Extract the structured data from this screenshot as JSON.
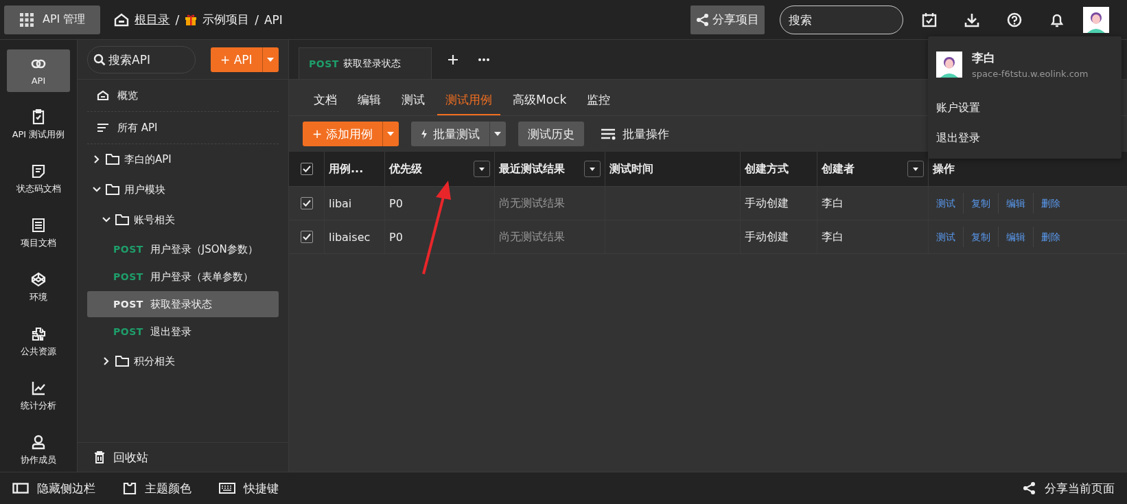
{
  "topbar": {
    "app_button": "API 管理",
    "breadcrumb": [
      {
        "label": "根目录",
        "kind": "home"
      },
      {
        "separator": "/",
        "label": "示例项目",
        "kind": "gift"
      },
      {
        "separator": "/",
        "label": "API",
        "kind": "plain"
      }
    ],
    "share_button": "分享项目",
    "search": {
      "placeholder": "搜索"
    }
  },
  "account_menu": {
    "name": "李白",
    "space": "space-f6tstu.w.eolink.com",
    "items": [
      "账户设置",
      "退出登录"
    ]
  },
  "rail": [
    {
      "label": "API",
      "selected": true
    },
    {
      "label": "API 测试用例",
      "selected": false
    },
    {
      "label": "状态码文档",
      "selected": false
    },
    {
      "label": "项目文档",
      "selected": false
    },
    {
      "label": "环境",
      "selected": false
    },
    {
      "label": "公共资源",
      "selected": false
    },
    {
      "label": "统计分析",
      "selected": false
    },
    {
      "label": "协作成员",
      "selected": false
    }
  ],
  "sidebar": {
    "search": {
      "placeholder": "搜索API"
    },
    "add_button": "+ API",
    "links": [
      "概览",
      "所有 API"
    ],
    "tree": [
      {
        "kind": "folder",
        "label": "李白的API",
        "expanded": false
      },
      {
        "kind": "folder",
        "label": "用户模块",
        "expanded": true,
        "children": [
          {
            "kind": "folder",
            "label": "账号相关",
            "expanded": true,
            "children": [
              {
                "kind": "api",
                "method": "POST",
                "label": "用户登录（JSON参数）",
                "selected": false
              },
              {
                "kind": "api",
                "method": "POST",
                "label": "用户登录（表单参数）",
                "selected": false
              },
              {
                "kind": "api",
                "method": "POST",
                "label": "获取登录状态",
                "selected": true
              },
              {
                "kind": "api",
                "method": "POST",
                "label": "退出登录",
                "selected": false
              }
            ]
          },
          {
            "kind": "folder",
            "label": "积分相关",
            "expanded": false
          }
        ]
      }
    ],
    "recycle": "回收站"
  },
  "open_tab": {
    "method": "POST",
    "title": "获取登录状态"
  },
  "subtabs": [
    {
      "label": "文档",
      "selected": false
    },
    {
      "label": "编辑",
      "selected": false
    },
    {
      "label": "测试",
      "selected": false
    },
    {
      "label": "测试用例",
      "selected": true
    },
    {
      "label": "高级Mock",
      "selected": false
    },
    {
      "label": "监控",
      "selected": false
    }
  ],
  "toolbar": {
    "add_case": "+ 添加用例",
    "batch_test": "批量测试",
    "history": "测试历史",
    "batch_ops": "批量操作"
  },
  "table": {
    "all_checked": true,
    "columns": [
      {
        "label": "用例...",
        "filter": false
      },
      {
        "label": "优先级",
        "filter": true
      },
      {
        "label": "最近测试结果",
        "filter": true
      },
      {
        "label": "测试时间",
        "filter": false
      },
      {
        "label": "创建方式",
        "filter": false
      },
      {
        "label": "创建者",
        "filter": true
      },
      {
        "label": "操作",
        "filter": false
      }
    ],
    "rows": [
      {
        "checked": true,
        "name": "libai",
        "priority": "P0",
        "result": "尚无测试结果",
        "method": "手动创建",
        "creator": "李白",
        "actions": [
          "测试",
          "复制",
          "编辑",
          "删除"
        ]
      },
      {
        "checked": true,
        "name": "libaisec",
        "priority": "P0",
        "result": "尚无测试结果",
        "method": "手动创建",
        "creator": "李白",
        "actions": [
          "测试",
          "复制",
          "编辑",
          "删除"
        ]
      }
    ]
  },
  "bottom_bar": {
    "items": [
      "隐藏侧边栏",
      "主题颜色",
      "快捷键"
    ],
    "share_page": "分享当前页面"
  }
}
